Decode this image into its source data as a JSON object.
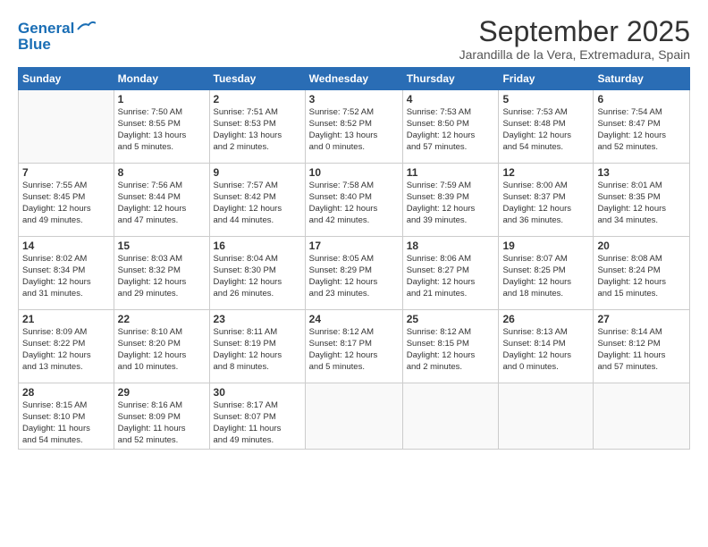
{
  "header": {
    "logo_line1": "General",
    "logo_line2": "Blue",
    "month_title": "September 2025",
    "subtitle": "Jarandilla de la Vera, Extremadura, Spain"
  },
  "weekdays": [
    "Sunday",
    "Monday",
    "Tuesday",
    "Wednesday",
    "Thursday",
    "Friday",
    "Saturday"
  ],
  "weeks": [
    [
      {
        "day": "",
        "info": ""
      },
      {
        "day": "1",
        "info": "Sunrise: 7:50 AM\nSunset: 8:55 PM\nDaylight: 13 hours\nand 5 minutes."
      },
      {
        "day": "2",
        "info": "Sunrise: 7:51 AM\nSunset: 8:53 PM\nDaylight: 13 hours\nand 2 minutes."
      },
      {
        "day": "3",
        "info": "Sunrise: 7:52 AM\nSunset: 8:52 PM\nDaylight: 13 hours\nand 0 minutes."
      },
      {
        "day": "4",
        "info": "Sunrise: 7:53 AM\nSunset: 8:50 PM\nDaylight: 12 hours\nand 57 minutes."
      },
      {
        "day": "5",
        "info": "Sunrise: 7:53 AM\nSunset: 8:48 PM\nDaylight: 12 hours\nand 54 minutes."
      },
      {
        "day": "6",
        "info": "Sunrise: 7:54 AM\nSunset: 8:47 PM\nDaylight: 12 hours\nand 52 minutes."
      }
    ],
    [
      {
        "day": "7",
        "info": "Sunrise: 7:55 AM\nSunset: 8:45 PM\nDaylight: 12 hours\nand 49 minutes."
      },
      {
        "day": "8",
        "info": "Sunrise: 7:56 AM\nSunset: 8:44 PM\nDaylight: 12 hours\nand 47 minutes."
      },
      {
        "day": "9",
        "info": "Sunrise: 7:57 AM\nSunset: 8:42 PM\nDaylight: 12 hours\nand 44 minutes."
      },
      {
        "day": "10",
        "info": "Sunrise: 7:58 AM\nSunset: 8:40 PM\nDaylight: 12 hours\nand 42 minutes."
      },
      {
        "day": "11",
        "info": "Sunrise: 7:59 AM\nSunset: 8:39 PM\nDaylight: 12 hours\nand 39 minutes."
      },
      {
        "day": "12",
        "info": "Sunrise: 8:00 AM\nSunset: 8:37 PM\nDaylight: 12 hours\nand 36 minutes."
      },
      {
        "day": "13",
        "info": "Sunrise: 8:01 AM\nSunset: 8:35 PM\nDaylight: 12 hours\nand 34 minutes."
      }
    ],
    [
      {
        "day": "14",
        "info": "Sunrise: 8:02 AM\nSunset: 8:34 PM\nDaylight: 12 hours\nand 31 minutes."
      },
      {
        "day": "15",
        "info": "Sunrise: 8:03 AM\nSunset: 8:32 PM\nDaylight: 12 hours\nand 29 minutes."
      },
      {
        "day": "16",
        "info": "Sunrise: 8:04 AM\nSunset: 8:30 PM\nDaylight: 12 hours\nand 26 minutes."
      },
      {
        "day": "17",
        "info": "Sunrise: 8:05 AM\nSunset: 8:29 PM\nDaylight: 12 hours\nand 23 minutes."
      },
      {
        "day": "18",
        "info": "Sunrise: 8:06 AM\nSunset: 8:27 PM\nDaylight: 12 hours\nand 21 minutes."
      },
      {
        "day": "19",
        "info": "Sunrise: 8:07 AM\nSunset: 8:25 PM\nDaylight: 12 hours\nand 18 minutes."
      },
      {
        "day": "20",
        "info": "Sunrise: 8:08 AM\nSunset: 8:24 PM\nDaylight: 12 hours\nand 15 minutes."
      }
    ],
    [
      {
        "day": "21",
        "info": "Sunrise: 8:09 AM\nSunset: 8:22 PM\nDaylight: 12 hours\nand 13 minutes."
      },
      {
        "day": "22",
        "info": "Sunrise: 8:10 AM\nSunset: 8:20 PM\nDaylight: 12 hours\nand 10 minutes."
      },
      {
        "day": "23",
        "info": "Sunrise: 8:11 AM\nSunset: 8:19 PM\nDaylight: 12 hours\nand 8 minutes."
      },
      {
        "day": "24",
        "info": "Sunrise: 8:12 AM\nSunset: 8:17 PM\nDaylight: 12 hours\nand 5 minutes."
      },
      {
        "day": "25",
        "info": "Sunrise: 8:12 AM\nSunset: 8:15 PM\nDaylight: 12 hours\nand 2 minutes."
      },
      {
        "day": "26",
        "info": "Sunrise: 8:13 AM\nSunset: 8:14 PM\nDaylight: 12 hours\nand 0 minutes."
      },
      {
        "day": "27",
        "info": "Sunrise: 8:14 AM\nSunset: 8:12 PM\nDaylight: 11 hours\nand 57 minutes."
      }
    ],
    [
      {
        "day": "28",
        "info": "Sunrise: 8:15 AM\nSunset: 8:10 PM\nDaylight: 11 hours\nand 54 minutes."
      },
      {
        "day": "29",
        "info": "Sunrise: 8:16 AM\nSunset: 8:09 PM\nDaylight: 11 hours\nand 52 minutes."
      },
      {
        "day": "30",
        "info": "Sunrise: 8:17 AM\nSunset: 8:07 PM\nDaylight: 11 hours\nand 49 minutes."
      },
      {
        "day": "",
        "info": ""
      },
      {
        "day": "",
        "info": ""
      },
      {
        "day": "",
        "info": ""
      },
      {
        "day": "",
        "info": ""
      }
    ]
  ]
}
